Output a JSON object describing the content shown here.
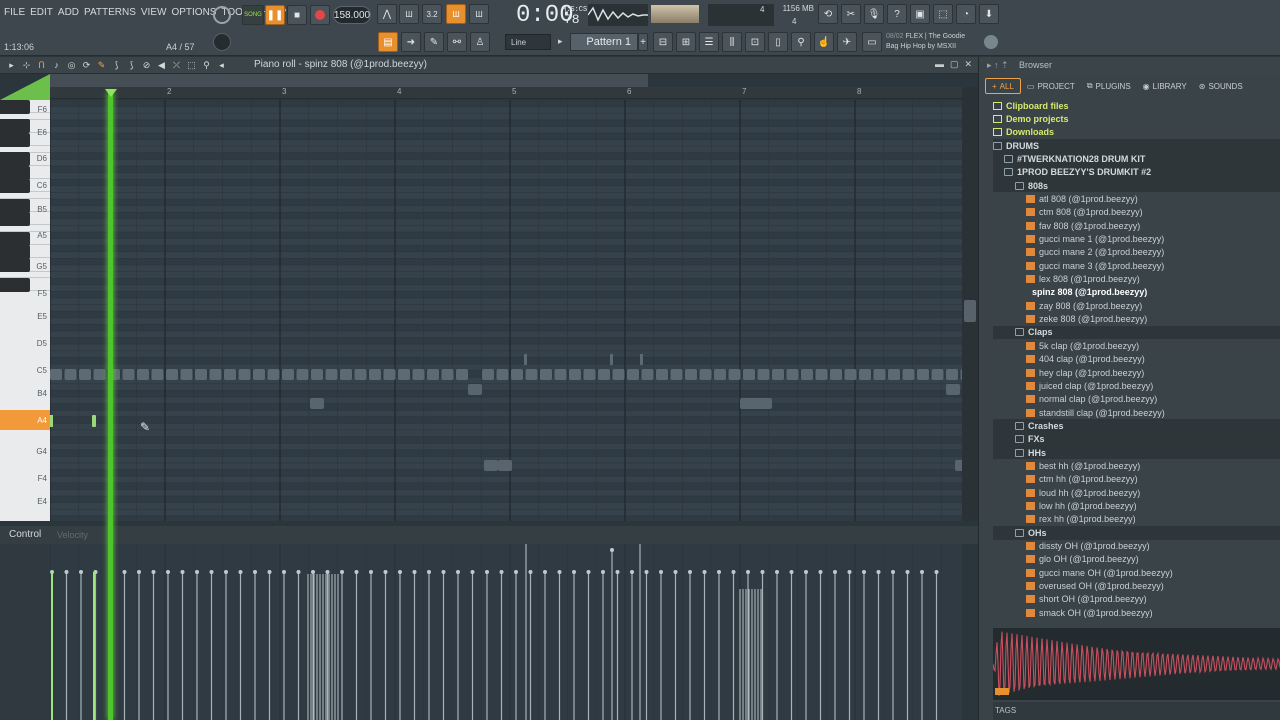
{
  "menu": [
    "FILE",
    "EDIT",
    "ADD",
    "PATTERNS",
    "VIEW",
    "OPTIONS",
    "TOOLS",
    "HELP"
  ],
  "hint_left": "1:13:06",
  "hint_right": "A4 / 57",
  "transport": {
    "song_label": "SONG",
    "tempo": "158.000",
    "time_main": "0:00",
    "time_ms": "78",
    "time_unit": "M:S:CS"
  },
  "stats": {
    "memory": "1156 MB",
    "cpu_count": "4",
    "voices": "4"
  },
  "toolbar": {
    "snap_mode": "Line",
    "pattern": "Pattern 1",
    "news_index": "08/02",
    "news_title": "FLEX | The Goodie",
    "news_sub": "Bag Hip Hop by MSXII"
  },
  "piano_roll": {
    "title": "Piano roll - spinz 808 (@1prod.beezyy)",
    "bars": [
      "2",
      "3",
      "4",
      "5",
      "6",
      "7",
      "8"
    ],
    "keys": [
      "F6",
      "E6",
      "D6",
      "C6",
      "B5",
      "A5",
      "G5",
      "F5",
      "E5",
      "D5",
      "C5",
      "B4",
      "A4",
      "G4",
      "F4",
      "E4"
    ],
    "active_key": "A4",
    "control_label": "Control",
    "velocity_label": "Velocity"
  },
  "browser": {
    "title": "Browser",
    "tabs": [
      "ALL",
      "PROJECT",
      "PLUGINS",
      "LIBRARY",
      "SOUNDS"
    ],
    "tree": [
      {
        "label": "Clipboard files",
        "type": "root",
        "depth": 0
      },
      {
        "label": "Demo projects",
        "type": "root",
        "depth": 0
      },
      {
        "label": "Downloads",
        "type": "root",
        "depth": 0
      },
      {
        "label": "DRUMS",
        "type": "folder",
        "depth": 0
      },
      {
        "label": "#TWERKNATION28 DRUM KIT",
        "type": "folder",
        "depth": 1
      },
      {
        "label": "1PROD BEEZYY'S DRUMKIT #2",
        "type": "folder",
        "depth": 1
      },
      {
        "label": "808s",
        "type": "folder",
        "depth": 2
      },
      {
        "label": "atl 808 (@1prod.beezyy)",
        "type": "file",
        "depth": 3
      },
      {
        "label": "ctm 808 (@1prod.beezyy)",
        "type": "file",
        "depth": 3
      },
      {
        "label": "fav 808 (@1prod.beezyy)",
        "type": "file",
        "depth": 3
      },
      {
        "label": "gucci mane 1 (@1prod.beezyy)",
        "type": "file",
        "depth": 3
      },
      {
        "label": "gucci mane 2 (@1prod.beezyy)",
        "type": "file",
        "depth": 3
      },
      {
        "label": "gucci mane 3 (@1prod.beezyy)",
        "type": "file",
        "depth": 3
      },
      {
        "label": "lex 808 (@1prod.beezyy)",
        "type": "file",
        "depth": 3
      },
      {
        "label": "spinz 808 (@1prod.beezyy)",
        "type": "selected",
        "depth": 3
      },
      {
        "label": "zay 808 (@1prod.beezyy)",
        "type": "file",
        "depth": 3
      },
      {
        "label": "zeke 808 (@1prod.beezyy)",
        "type": "file",
        "depth": 3
      },
      {
        "label": "Claps",
        "type": "folder",
        "depth": 2
      },
      {
        "label": "5k clap (@1prod.beezyy)",
        "type": "file",
        "depth": 3
      },
      {
        "label": "404 clap (@1prod.beezyy)",
        "type": "file",
        "depth": 3
      },
      {
        "label": "hey clap (@1prod.beezyy)",
        "type": "file",
        "depth": 3
      },
      {
        "label": "juiced clap (@1prod.beezyy)",
        "type": "file",
        "depth": 3
      },
      {
        "label": "normal clap (@1prod.beezyy)",
        "type": "file",
        "depth": 3
      },
      {
        "label": "standstill clap (@1prod.beezyy)",
        "type": "file",
        "depth": 3
      },
      {
        "label": "Crashes",
        "type": "folder",
        "depth": 2
      },
      {
        "label": "FXs",
        "type": "folder",
        "depth": 2
      },
      {
        "label": "HHs",
        "type": "folder",
        "depth": 2
      },
      {
        "label": "best hh (@1prod.beezyy)",
        "type": "file",
        "depth": 3
      },
      {
        "label": "ctm hh (@1prod.beezyy)",
        "type": "file",
        "depth": 3
      },
      {
        "label": "loud hh (@1prod.beezyy)",
        "type": "file",
        "depth": 3
      },
      {
        "label": "low hh (@1prod.beezyy)",
        "type": "file",
        "depth": 3
      },
      {
        "label": "rex hh (@1prod.beezyy)",
        "type": "file",
        "depth": 3
      },
      {
        "label": "OHs",
        "type": "folder",
        "depth": 2
      },
      {
        "label": "dissty OH (@1prod.beezyy)",
        "type": "file",
        "depth": 3
      },
      {
        "label": "glo OH (@1prod.beezyy)",
        "type": "file",
        "depth": 3
      },
      {
        "label": "gucci mane OH (@1prod.beezyy)",
        "type": "file",
        "depth": 3
      },
      {
        "label": "overused OH (@1prod.beezyy)",
        "type": "file",
        "depth": 3
      },
      {
        "label": "short OH (@1prod.beezyy)",
        "type": "file",
        "depth": 3
      },
      {
        "label": "smack OH (@1prod.beezyy)",
        "type": "file",
        "depth": 3
      }
    ],
    "tags_label": "TAGS"
  },
  "colors": {
    "accent": "#f0a14a",
    "playhead": "#4fc42d",
    "wave": "#c9505e"
  }
}
